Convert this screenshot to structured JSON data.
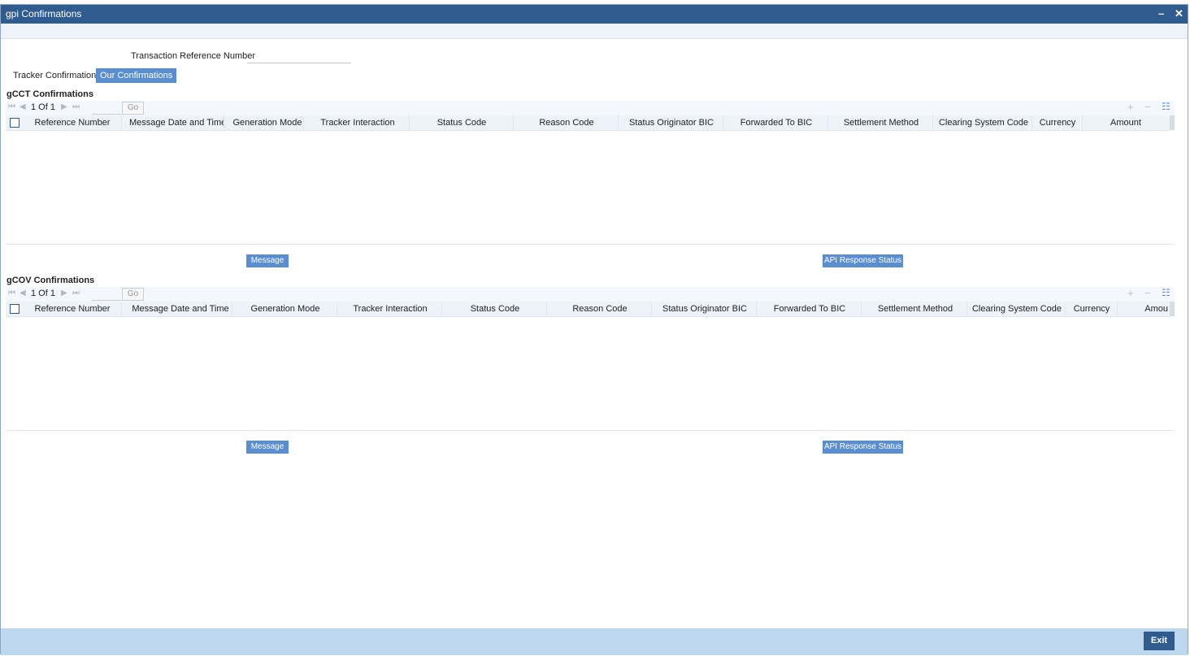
{
  "window": {
    "title": "gpi Confirmations",
    "minimize_glyph": "–",
    "close_glyph": "✕"
  },
  "form": {
    "trn_label": "Transaction Reference Number",
    "trn_value": ""
  },
  "tabs": [
    {
      "label": "Tracker Confirmations",
      "active": false
    },
    {
      "label": "Our Confirmations",
      "active": true
    }
  ],
  "gcct": {
    "title": "gCCT Confirmations",
    "pager": {
      "text": "1 Of 1",
      "go_label": "Go",
      "go_value": ""
    },
    "columns": [
      "Reference Number",
      "Message Date and Time",
      "Generation Mode",
      "Tracker Interaction",
      "Status Code",
      "Reason Code",
      "Status Originator BIC",
      "Forwarded To BIC",
      "Settlement Method",
      "Clearing System Code",
      "Currency",
      "Amount"
    ],
    "rows": [],
    "message_button": "Message",
    "api_button": "API Response Status"
  },
  "gcov": {
    "title": "gCOV Confirmations",
    "pager": {
      "text": "1 Of 1",
      "go_label": "Go",
      "go_value": ""
    },
    "columns": [
      "Reference Number",
      "Message Date and Time",
      "Generation Mode",
      "Tracker Interaction",
      "Status Code",
      "Reason Code",
      "Status Originator BIC",
      "Forwarded To BIC",
      "Settlement Method",
      "Clearing System Code",
      "Currency",
      "Amou"
    ],
    "rows": [],
    "message_button": "Message",
    "api_button": "API Response Status"
  },
  "toolbar_glyphs": {
    "add": "+",
    "remove": "−",
    "view": "☷"
  },
  "footer": {
    "exit_label": "Exit"
  },
  "colors": {
    "titlebar": "#2f5b8e",
    "accent": "#5b8ed0",
    "footer": "#bdd7ee"
  }
}
